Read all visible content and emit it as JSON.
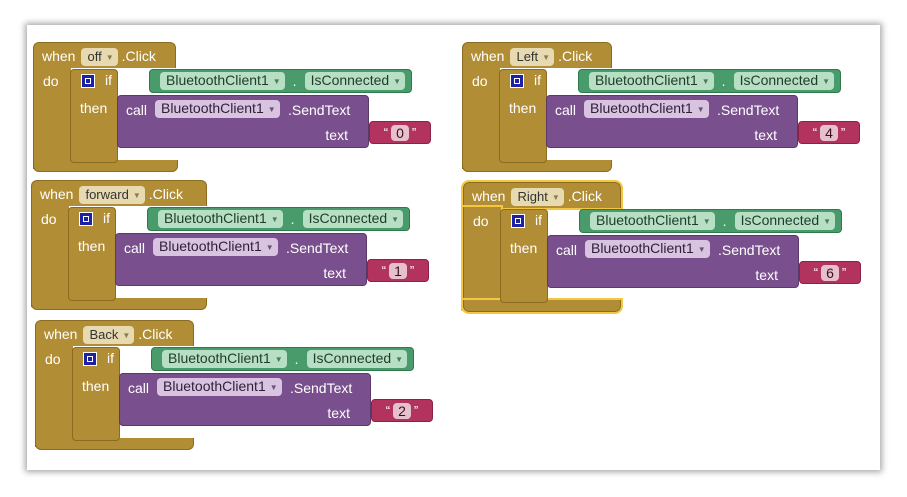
{
  "keywords": {
    "when": "when",
    "do": "do",
    "if": "if",
    "then": "then",
    "call": "call",
    "text": "text",
    "click_suffix": ".Click",
    "dot": ".",
    "open_quote": "“",
    "close_quote": "”"
  },
  "condition": {
    "component": "BluetoothClient1",
    "property": "IsConnected"
  },
  "action": {
    "component": "BluetoothClient1",
    "method": ".SendText"
  },
  "events": [
    {
      "button": "off",
      "send_value": "0",
      "selected": false
    },
    {
      "button": "forward",
      "send_value": "1",
      "selected": false
    },
    {
      "button": "Back",
      "send_value": "2",
      "selected": false
    },
    {
      "button": "Left",
      "send_value": "4",
      "selected": false
    },
    {
      "button": "Right",
      "send_value": "6",
      "selected": true
    }
  ],
  "colors": {
    "event_block": "#b18e35",
    "condition_block": "#4a9b6c",
    "call_block": "#7a4f8d",
    "text_block": "#b3335f",
    "selection_outline": "#f2c744"
  }
}
